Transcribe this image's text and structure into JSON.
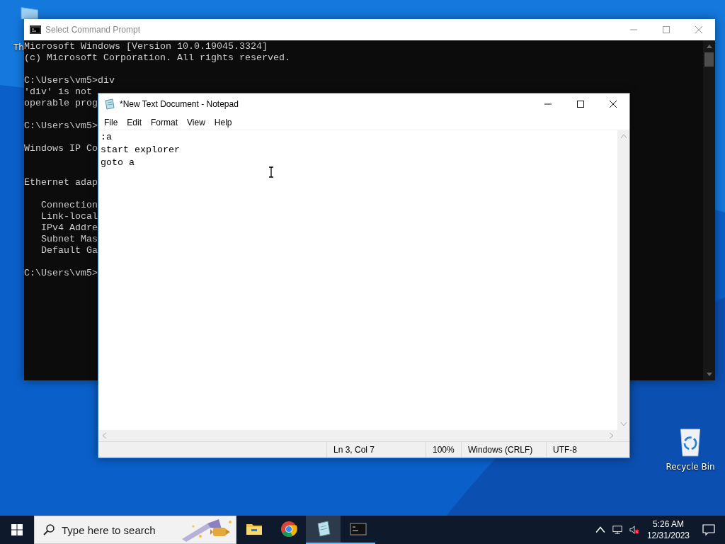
{
  "desktop_icons": [
    {
      "kind": "computer",
      "label": "Th"
    },
    {
      "kind": "recycle",
      "label": "Recycle Bin"
    }
  ],
  "cmd": {
    "title": "Select Command Prompt",
    "lines": [
      {
        "kind": "text",
        "text": "Microsoft Windows [Version 10.0.19045.3324]"
      },
      {
        "kind": "text",
        "text": "(c) Microsoft Corporation. All rights reserved."
      },
      {
        "kind": "blank"
      },
      {
        "kind": "text",
        "text": "C:\\Users\\vm5>div"
      },
      {
        "kind": "text",
        "text": "'div' is not"
      },
      {
        "kind": "text",
        "text": "operable prog"
      },
      {
        "kind": "blank"
      },
      {
        "kind": "text",
        "text": "C:\\Users\\vm5>"
      },
      {
        "kind": "blank"
      },
      {
        "kind": "text",
        "text": "Windows IP Co"
      },
      {
        "kind": "blank"
      },
      {
        "kind": "blank"
      },
      {
        "kind": "text",
        "text": "Ethernet adap"
      },
      {
        "kind": "blank"
      },
      {
        "kind": "text",
        "text": "   Connection"
      },
      {
        "kind": "text",
        "text": "   Link-local"
      },
      {
        "kind": "text",
        "text": "   IPv4 Addre"
      },
      {
        "kind": "text",
        "text": "   Subnet Mas"
      },
      {
        "kind": "text",
        "text": "   Default Ga"
      },
      {
        "kind": "blank"
      },
      {
        "kind": "text",
        "text": "C:\\Users\\vm5>"
      }
    ]
  },
  "notepad": {
    "title": "*New Text Document - Notepad",
    "menu": [
      "File",
      "Edit",
      "Format",
      "View",
      "Help"
    ],
    "lines": [
      ":a",
      "start explorer",
      "goto a"
    ],
    "status": [
      "Ln 3, Col 7",
      "100%",
      "Windows (CRLF)",
      "UTF-8"
    ]
  },
  "taskbar": {
    "search": {
      "placeholder": "Type here to search"
    },
    "apps": [
      {
        "kind": "explorer",
        "selected": false,
        "running": false
      },
      {
        "kind": "chrome",
        "selected": false,
        "running": false
      },
      {
        "kind": "notepad",
        "selected": true,
        "running": true
      },
      {
        "kind": "cmd",
        "selected": false,
        "running": true
      }
    ],
    "clock": {
      "time": "5:26 AM",
      "date": "12/31/2023"
    }
  }
}
